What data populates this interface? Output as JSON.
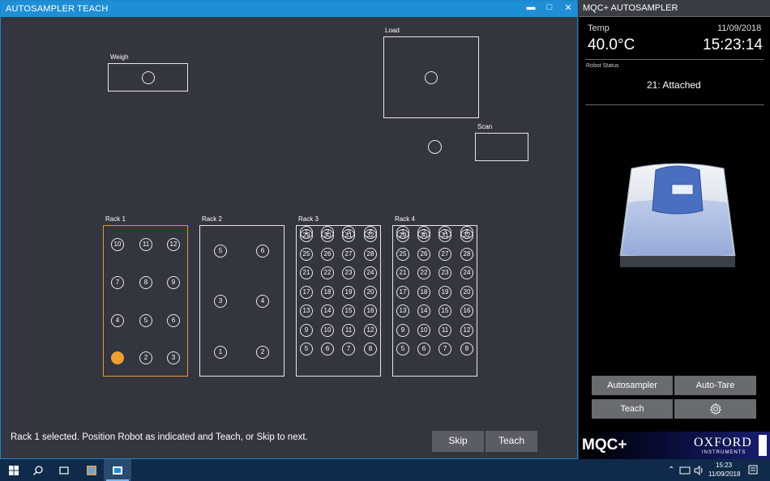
{
  "left_window": {
    "title": "AUTOSAMPLER TEACH",
    "controls": {
      "minimize": "▬",
      "maximize": "□",
      "close": "✕"
    },
    "zones": {
      "weigh": "Weigh",
      "load": "Load",
      "scan": "Scan"
    },
    "racks": [
      {
        "label": "Rack 1",
        "selected": true,
        "active_slot": 1,
        "slots": [
          "10",
          "11",
          "12",
          "7",
          "8",
          "9",
          "4",
          "5",
          "6",
          "1",
          "2",
          "3"
        ]
      },
      {
        "label": "Rack 2",
        "selected": false,
        "slots": [
          "5",
          "6",
          "3",
          "4",
          "1",
          "2"
        ]
      },
      {
        "label": "Rack 3",
        "selected": false,
        "slots": [
          "29",
          "30",
          "31",
          "32",
          "25",
          "26",
          "27",
          "28",
          "21",
          "22",
          "23",
          "24",
          "17",
          "18",
          "19",
          "20",
          "13",
          "14",
          "15",
          "16",
          "9",
          "10",
          "11",
          "12",
          "5",
          "6",
          "7",
          "8",
          "1",
          "2",
          "3",
          "4"
        ]
      },
      {
        "label": "Rack 4",
        "selected": false,
        "slots": [
          "29",
          "30",
          "31",
          "32",
          "25",
          "26",
          "27",
          "28",
          "21",
          "22",
          "23",
          "24",
          "17",
          "18",
          "19",
          "20",
          "13",
          "14",
          "15",
          "16",
          "9",
          "10",
          "11",
          "12",
          "5",
          "6",
          "7",
          "8",
          "1",
          "2",
          "3",
          "4"
        ]
      }
    ],
    "status_message": "Rack 1 selected. Position Robot as indicated and Teach, or Skip to next.",
    "skip_label": "Skip",
    "teach_label": "Teach"
  },
  "right_window": {
    "title": "MQC+ AUTOSAMPLER",
    "temp_label": "Temp",
    "temp_value": "40.0°C",
    "date": "11/09/2018",
    "time": "15:23:14",
    "robot_status_label": "Robot Status",
    "robot_status_value": "21: Attached",
    "buttons": {
      "autosampler": "Autosampler",
      "auto_tare": "Auto-Tare",
      "teach": "Teach",
      "settings_icon": "gear-icon"
    },
    "brand": "MQC+",
    "logo_text": "OXFORD",
    "logo_sub": "INSTRUMENTS"
  },
  "taskbar": {
    "time": "15:23",
    "date": "11/09/2018",
    "icons": [
      "windows-start-icon",
      "search-icon",
      "task-view-icon",
      "app-icon",
      "autosampler-app-icon"
    ],
    "tray": [
      "chevron-up-icon",
      "network-icon",
      "volume-icon",
      "notification-icon"
    ]
  }
}
